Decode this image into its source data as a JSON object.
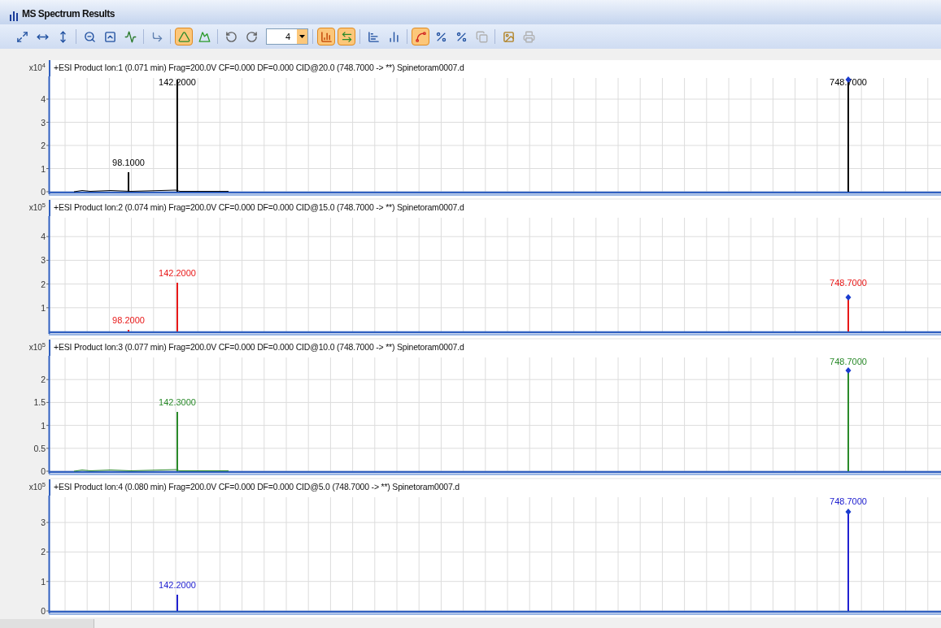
{
  "window": {
    "title": "MS Spectrum Results"
  },
  "toolbar": {
    "groups": [
      [
        {
          "selected": false,
          "disabled": false
        },
        {
          "selected": false,
          "disabled": false
        },
        {
          "selected": false,
          "disabled": false
        }
      ],
      [
        {
          "selected": false,
          "disabled": false
        },
        {
          "selected": false,
          "disabled": false
        },
        {
          "selected": false,
          "disabled": false
        }
      ],
      [
        {
          "selected": false,
          "disabled": false
        }
      ],
      [
        {
          "selected": true,
          "disabled": false
        },
        {
          "selected": false,
          "disabled": false
        }
      ],
      [
        {
          "selected": false,
          "disabled": false
        },
        {
          "selected": false,
          "disabled": false
        }
      ],
      [
        {
          "selected": true,
          "disabled": false
        },
        {
          "selected": true,
          "disabled": false
        }
      ],
      [
        {
          "selected": false,
          "disabled": false
        },
        {
          "selected": false,
          "disabled": false
        }
      ],
      [
        {
          "selected": true,
          "disabled": false
        },
        {
          "selected": false,
          "disabled": false
        },
        {
          "selected": false,
          "disabled": false
        },
        {
          "selected": false,
          "disabled": true
        }
      ],
      [
        {
          "selected": false,
          "disabled": false
        },
        {
          "selected": false,
          "disabled": true
        }
      ]
    ],
    "spin_value": "4"
  },
  "panels": [
    {
      "title": "+ESI Product Ion:1 (0.071 min) Frag=200.0V CF=0.000 DF=0.000 CID@20.0 (748.7000 -> **) Spinetoram0007.d",
      "scale_label": "x10$^{4}$",
      "color": "#000000",
      "y_ticks": [
        "4",
        "3",
        "2",
        "1",
        "0"
      ],
      "peak_labels": [
        "98.1000",
        "142.2000",
        "748.7000"
      ],
      "precursor_marker": true
    },
    {
      "title": "+ESI Product Ion:2 (0.074 min) Frag=200.0V CF=0.000 DF=0.000 CID@15.0 (748.7000 -> **) Spinetoram0007.d",
      "scale_label": "x10$^{5}$",
      "color": "#e81818",
      "y_ticks": [
        "4",
        "3",
        "2",
        "1"
      ],
      "peak_labels": [
        "98.2000",
        "142.2000",
        "748.7000"
      ],
      "precursor_marker": true
    },
    {
      "title": "+ESI Product Ion:3 (0.077 min) Frag=200.0V CF=0.000 DF=0.000 CID@10.0 (748.7000 -> **) Spinetoram0007.d",
      "scale_label": "x10$^{5}$",
      "color": "#2a8a2a",
      "y_ticks": [
        "2",
        "1.5",
        "1",
        "0.5",
        "0"
      ],
      "peak_labels": [
        "142.3000",
        "748.7000"
      ],
      "precursor_marker": true
    },
    {
      "title": "+ESI Product Ion:4 (0.080 min) Frag=200.0V CF=0.000 DF=0.000 CID@5.0 (748.7000 -> **) Spinetoram0007.d",
      "scale_label": "x10$^{5}$",
      "color": "#2020d0",
      "y_ticks": [
        "3",
        "2",
        "1",
        "0"
      ],
      "peak_labels": [
        "142.2000",
        "748.7000"
      ],
      "precursor_marker": true
    }
  ]
}
